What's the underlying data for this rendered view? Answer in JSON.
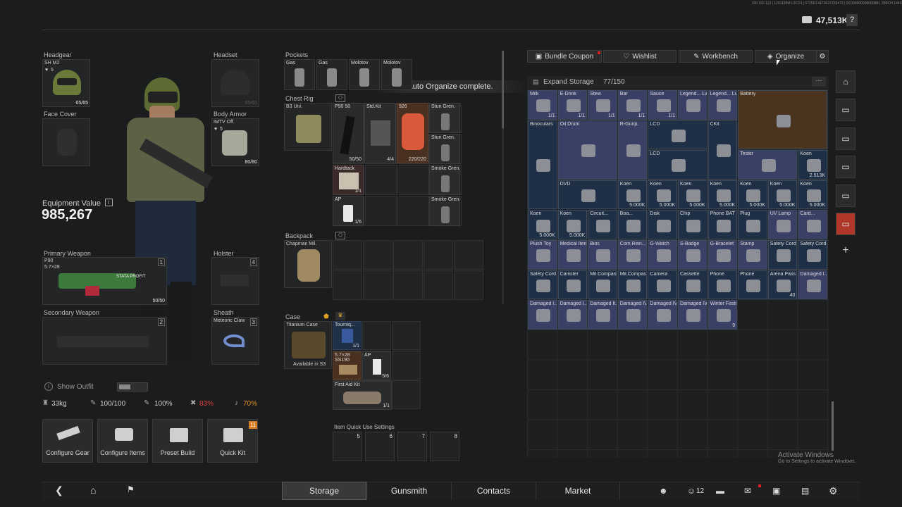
{
  "header": {
    "currency": "47,513K",
    "help": "?",
    "tiny": "100.192.113 | 1201195M.U1C01 | 5725D14473E37225472 | 5C0000000000008B | 25BCH 144X"
  },
  "equipment": {
    "headgear": {
      "label": "Headgear",
      "name": "SH M2",
      "level": "5",
      "count": "65/65"
    },
    "headset": {
      "label": "Headset",
      "count": "65/65"
    },
    "face_cover": {
      "label": "Face Cover"
    },
    "body_armor": {
      "label": "Body Armor",
      "name": "IMTV Off.",
      "level": "5",
      "count": "80/80"
    },
    "value_label": "Equipment Value",
    "value": "985,267",
    "primary": {
      "label": "Primary Weapon",
      "name": "P90",
      "ammo": "5.7×28",
      "slot": "1",
      "count": "50/50",
      "brand": "STATA PROFIT"
    },
    "holster": {
      "label": "Holster",
      "slot": "4"
    },
    "secondary": {
      "label": "Secondary Weapon",
      "slot": "2"
    },
    "sheath": {
      "label": "Sheath",
      "name": "Meteoric Claw",
      "slot": "3"
    },
    "show_outfit": "Show Outfit",
    "stats": {
      "weight": "33kg",
      "s1": "100/100",
      "s2": "100%",
      "s3": "83%",
      "s4": "70%"
    }
  },
  "buttons": {
    "configure_gear": "Configure Gear",
    "configure_items": "Configure Items",
    "preset_build": "Preset Build",
    "quick_kit": "Quick Kit",
    "quick_kit_badge": "11"
  },
  "pockets": {
    "label": "Pockets",
    "items": [
      "Gas",
      "Gas",
      "Molotov",
      "Molotov"
    ]
  },
  "chest_rig": {
    "label": "Chest Rig",
    "name": "B3 Uni.",
    "items": {
      "p90": "P90 50",
      "p90_ct": "50/50",
      "stdkit": "Std.Kit",
      "stdkit_ct": "4/4",
      "n926": "926",
      "n926_ct": "220/220",
      "stun1": "Stun Gren.",
      "stun2": "Stun Gren.",
      "hardtack": "Hardtack",
      "hardtack_ct": "1/1",
      "smoke1": "Smoke Gren.",
      "smoke2": "Smoke Gren.",
      "ap": "AP",
      "ap_ct": "1/6"
    }
  },
  "toast": "Auto Organize complete.",
  "backpack": {
    "label": "Backpack",
    "name": "Chapman Mil."
  },
  "case": {
    "label": "Case",
    "name": "Titanium Case",
    "avail": "Available in S3",
    "tourniq": "Tourniq...",
    "tourniq_ct": "1/1",
    "ammo": "5.7×28 SS190",
    "ap": "AP",
    "ap_ct": "5/6",
    "fak": "First Aid Kit",
    "fak_ct": "1/1"
  },
  "quick_use": {
    "label": "Item Quick Use Settings",
    "slots": [
      "5",
      "6",
      "7",
      "8"
    ]
  },
  "storage_tabs": {
    "bundle": "Bundle Coupon",
    "wishlist": "Wishlist",
    "workbench": "Workbench",
    "organize": "Organize"
  },
  "storage": {
    "expand": "Expand Storage",
    "count": "77/150",
    "more": "···"
  },
  "storage_items": [
    {
      "r": 0,
      "c": 0,
      "w": 1,
      "h": 1,
      "n": "Milk",
      "ct": "1/1",
      "col": "#3a3f66"
    },
    {
      "r": 0,
      "c": 1,
      "w": 1,
      "h": 1,
      "n": "E-Drink",
      "ct": "1/1",
      "col": "#3a3f66"
    },
    {
      "r": 0,
      "c": 2,
      "w": 1,
      "h": 1,
      "n": "Stew",
      "ct": "1/1",
      "col": "#3a3f66"
    },
    {
      "r": 0,
      "c": 3,
      "w": 1,
      "h": 1,
      "n": "Bar",
      "ct": "1/1",
      "col": "#3a3f66"
    },
    {
      "r": 0,
      "c": 4,
      "w": 1,
      "h": 1,
      "n": "Sauce",
      "ct": "1/1",
      "col": "#3a3f66"
    },
    {
      "r": 0,
      "c": 5,
      "w": 1,
      "h": 1,
      "n": "Legend... Lv. 3 Placing...",
      "ct": "",
      "col": "#3a3f66"
    },
    {
      "r": 0,
      "c": 6,
      "w": 1,
      "h": 1,
      "n": "Legend... Lv. 3",
      "ct": "",
      "col": "#3a3f66"
    },
    {
      "r": 0,
      "c": 7,
      "w": 3,
      "h": 2,
      "n": "Battery",
      "ct": "",
      "col": "#4a3420"
    },
    {
      "r": 1,
      "c": 0,
      "w": 1,
      "h": 3,
      "n": "Binoculars",
      "ct": "",
      "col": "#1f3046"
    },
    {
      "r": 1,
      "c": 1,
      "w": 2,
      "h": 2,
      "n": "Oil Drum",
      "ct": "",
      "col": "#3a3f66"
    },
    {
      "r": 1,
      "c": 3,
      "w": 1,
      "h": 2,
      "n": "R-Gunp.",
      "ct": "",
      "col": "#3a3f66"
    },
    {
      "r": 1,
      "c": 4,
      "w": 2,
      "h": 1,
      "n": "LCD",
      "ct": "",
      "col": "#1f3046"
    },
    {
      "r": 1,
      "c": 6,
      "w": 1,
      "h": 2,
      "n": "CKit",
      "ct": "",
      "col": "#1f3046"
    },
    {
      "r": 2,
      "c": 4,
      "w": 2,
      "h": 1,
      "n": "LCD",
      "ct": "",
      "col": "#1f3046"
    },
    {
      "r": 2,
      "c": 7,
      "w": 2,
      "h": 1,
      "n": "Tester",
      "ct": "",
      "col": "#3a3f66"
    },
    {
      "r": 2,
      "c": 9,
      "w": 1,
      "h": 1,
      "n": "Koen",
      "ct": "2.513K",
      "col": "#1f3046"
    },
    {
      "r": 3,
      "c": 1,
      "w": 2,
      "h": 1,
      "n": "DVD",
      "ct": "",
      "col": "#1f3046"
    },
    {
      "r": 3,
      "c": 3,
      "w": 1,
      "h": 1,
      "n": "Koen",
      "ct": "5.000K",
      "col": "#1f3046"
    },
    {
      "r": 3,
      "c": 4,
      "w": 1,
      "h": 1,
      "n": "Koen",
      "ct": "5.000K",
      "col": "#1f3046"
    },
    {
      "r": 3,
      "c": 5,
      "w": 1,
      "h": 1,
      "n": "Koen",
      "ct": "5.000K",
      "col": "#1f3046"
    },
    {
      "r": 3,
      "c": 6,
      "w": 1,
      "h": 1,
      "n": "Koen",
      "ct": "5.000K",
      "col": "#1f3046"
    },
    {
      "r": 3,
      "c": 7,
      "w": 1,
      "h": 1,
      "n": "Koen",
      "ct": "5.000K",
      "col": "#1f3046"
    },
    {
      "r": 3,
      "c": 8,
      "w": 1,
      "h": 1,
      "n": "Koen",
      "ct": "5.000K",
      "col": "#1f3046"
    },
    {
      "r": 3,
      "c": 9,
      "w": 1,
      "h": 1,
      "n": "Koen",
      "ct": "5.000K",
      "col": "#1f3046"
    },
    {
      "r": 4,
      "c": 0,
      "w": 1,
      "h": 1,
      "n": "Koen",
      "ct": "5.000K",
      "col": "#1f3046"
    },
    {
      "r": 4,
      "c": 1,
      "w": 1,
      "h": 1,
      "n": "Koen",
      "ct": "5.000K",
      "col": "#1f3046"
    },
    {
      "r": 4,
      "c": 2,
      "w": 1,
      "h": 1,
      "n": "Circuit...",
      "ct": "",
      "col": "#1f3046"
    },
    {
      "r": 4,
      "c": 3,
      "w": 1,
      "h": 1,
      "n": "Boa...",
      "ct": "",
      "col": "#1f3046"
    },
    {
      "r": 4,
      "c": 4,
      "w": 1,
      "h": 1,
      "n": "Disk",
      "ct": "",
      "col": "#1f3046"
    },
    {
      "r": 4,
      "c": 5,
      "w": 1,
      "h": 1,
      "n": "Chip",
      "ct": "",
      "col": "#1f3046"
    },
    {
      "r": 4,
      "c": 6,
      "w": 1,
      "h": 1,
      "n": "Phone BAT",
      "ct": "",
      "col": "#1f3046"
    },
    {
      "r": 4,
      "c": 7,
      "w": 1,
      "h": 1,
      "n": "Plug",
      "ct": "",
      "col": "#1f3046"
    },
    {
      "r": 4,
      "c": 8,
      "w": 1,
      "h": 1,
      "n": "UV Lamp",
      "ct": "",
      "col": "#3a3f66"
    },
    {
      "r": 4,
      "c": 9,
      "w": 1,
      "h": 1,
      "n": "Card...",
      "ct": "",
      "col": "#3a3f66"
    },
    {
      "r": 5,
      "c": 0,
      "w": 1,
      "h": 1,
      "n": "Plush Toy",
      "ct": "",
      "col": "#3a3f66"
    },
    {
      "r": 5,
      "c": 1,
      "w": 1,
      "h": 1,
      "n": "Medical Items",
      "ct": "",
      "col": "#3a3f66"
    },
    {
      "r": 5,
      "c": 2,
      "w": 1,
      "h": 1,
      "n": "Bios",
      "ct": "",
      "col": "#3a3f66"
    },
    {
      "r": 5,
      "c": 3,
      "w": 1,
      "h": 1,
      "n": "Com.Rein...",
      "ct": "",
      "col": "#3a3f66"
    },
    {
      "r": 5,
      "c": 4,
      "w": 1,
      "h": 1,
      "n": "G-Watch",
      "ct": "",
      "col": "#3a3f66"
    },
    {
      "r": 5,
      "c": 5,
      "w": 1,
      "h": 1,
      "n": "S-Badge",
      "ct": "",
      "col": "#3a3f66"
    },
    {
      "r": 5,
      "c": 6,
      "w": 1,
      "h": 1,
      "n": "G-Bracelet",
      "ct": "",
      "col": "#3a3f66"
    },
    {
      "r": 5,
      "c": 7,
      "w": 1,
      "h": 1,
      "n": "Stamp",
      "ct": "",
      "col": "#3a3f66"
    },
    {
      "r": 5,
      "c": 8,
      "w": 1,
      "h": 1,
      "n": "Safety Cord",
      "ct": "",
      "col": "#1f3046"
    },
    {
      "r": 5,
      "c": 9,
      "w": 1,
      "h": 1,
      "n": "Safety Cord",
      "ct": "",
      "col": "#1f3046"
    },
    {
      "r": 6,
      "c": 0,
      "w": 1,
      "h": 1,
      "n": "Safety Cord",
      "ct": "",
      "col": "#1f3046"
    },
    {
      "r": 6,
      "c": 1,
      "w": 1,
      "h": 1,
      "n": "Canister",
      "ct": "",
      "col": "#1f3046"
    },
    {
      "r": 6,
      "c": 2,
      "w": 1,
      "h": 1,
      "n": "Mil.Compass",
      "ct": "",
      "col": "#1f3046"
    },
    {
      "r": 6,
      "c": 3,
      "w": 1,
      "h": 1,
      "n": "Mil.Compass",
      "ct": "",
      "col": "#1f3046"
    },
    {
      "r": 6,
      "c": 4,
      "w": 1,
      "h": 1,
      "n": "Camera",
      "ct": "",
      "col": "#1f3046"
    },
    {
      "r": 6,
      "c": 5,
      "w": 1,
      "h": 1,
      "n": "Cassette",
      "ct": "",
      "col": "#1f3046"
    },
    {
      "r": 6,
      "c": 6,
      "w": 1,
      "h": 1,
      "n": "Phone",
      "ct": "",
      "col": "#1f3046"
    },
    {
      "r": 6,
      "c": 7,
      "w": 1,
      "h": 1,
      "n": "Phone",
      "ct": "",
      "col": "#1f3046"
    },
    {
      "r": 6,
      "c": 8,
      "w": 1,
      "h": 1,
      "n": "Arena Pass",
      "ct": "40",
      "col": "#1f3046"
    },
    {
      "r": 6,
      "c": 9,
      "w": 1,
      "h": 1,
      "n": "Damaged I...",
      "ct": "",
      "col": "#3a3f66"
    },
    {
      "r": 7,
      "c": 0,
      "w": 1,
      "h": 1,
      "n": "Damaged I...",
      "ct": "",
      "col": "#3a3f66"
    },
    {
      "r": 7,
      "c": 1,
      "w": 1,
      "h": 1,
      "n": "Damaged I...",
      "ct": "",
      "col": "#3a3f66"
    },
    {
      "r": 7,
      "c": 2,
      "w": 1,
      "h": 1,
      "n": "Damaged II...",
      "ct": "",
      "col": "#3a3f66"
    },
    {
      "r": 7,
      "c": 3,
      "w": 1,
      "h": 1,
      "n": "Damaged IV...",
      "ct": "",
      "col": "#3a3f66"
    },
    {
      "r": 7,
      "c": 4,
      "w": 1,
      "h": 1,
      "n": "Damaged IV...",
      "ct": "",
      "col": "#3a3f66"
    },
    {
      "r": 7,
      "c": 5,
      "w": 1,
      "h": 1,
      "n": "Damaged IV...",
      "ct": "",
      "col": "#3a3f66"
    },
    {
      "r": 7,
      "c": 6,
      "w": 1,
      "h": 1,
      "n": "Winter Festival",
      "ct": "9",
      "col": "#3a3f66"
    }
  ],
  "windows": {
    "line1": "Activate Windows",
    "line2": "Go to Settings to activate Windows."
  },
  "nav": {
    "storage": "Storage",
    "gunsmith": "Gunsmith",
    "contacts": "Contacts",
    "market": "Market",
    "friends": "12"
  }
}
